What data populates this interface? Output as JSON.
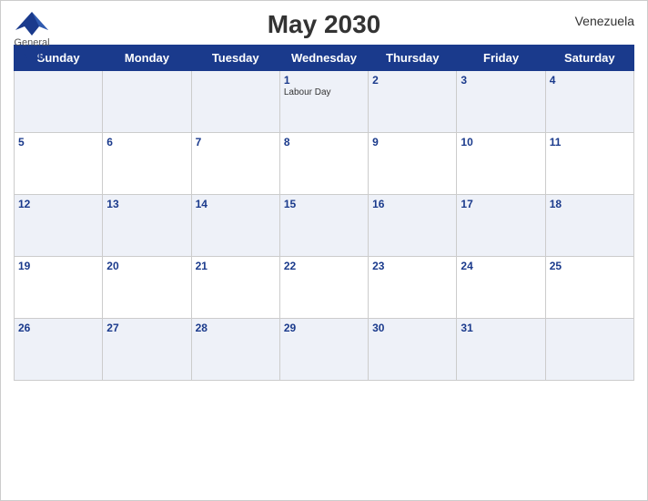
{
  "header": {
    "title": "May 2030",
    "country": "Venezuela",
    "logo": {
      "line1": "General",
      "line2": "Blue"
    }
  },
  "days_of_week": [
    "Sunday",
    "Monday",
    "Tuesday",
    "Wednesday",
    "Thursday",
    "Friday",
    "Saturday"
  ],
  "weeks": [
    [
      {
        "day": "",
        "holiday": ""
      },
      {
        "day": "",
        "holiday": ""
      },
      {
        "day": "",
        "holiday": ""
      },
      {
        "day": "1",
        "holiday": "Labour Day"
      },
      {
        "day": "2",
        "holiday": ""
      },
      {
        "day": "3",
        "holiday": ""
      },
      {
        "day": "4",
        "holiday": ""
      }
    ],
    [
      {
        "day": "5",
        "holiday": ""
      },
      {
        "day": "6",
        "holiday": ""
      },
      {
        "day": "7",
        "holiday": ""
      },
      {
        "day": "8",
        "holiday": ""
      },
      {
        "day": "9",
        "holiday": ""
      },
      {
        "day": "10",
        "holiday": ""
      },
      {
        "day": "11",
        "holiday": ""
      }
    ],
    [
      {
        "day": "12",
        "holiday": ""
      },
      {
        "day": "13",
        "holiday": ""
      },
      {
        "day": "14",
        "holiday": ""
      },
      {
        "day": "15",
        "holiday": ""
      },
      {
        "day": "16",
        "holiday": ""
      },
      {
        "day": "17",
        "holiday": ""
      },
      {
        "day": "18",
        "holiday": ""
      }
    ],
    [
      {
        "day": "19",
        "holiday": ""
      },
      {
        "day": "20",
        "holiday": ""
      },
      {
        "day": "21",
        "holiday": ""
      },
      {
        "day": "22",
        "holiday": ""
      },
      {
        "day": "23",
        "holiday": ""
      },
      {
        "day": "24",
        "holiday": ""
      },
      {
        "day": "25",
        "holiday": ""
      }
    ],
    [
      {
        "day": "26",
        "holiday": ""
      },
      {
        "day": "27",
        "holiday": ""
      },
      {
        "day": "28",
        "holiday": ""
      },
      {
        "day": "29",
        "holiday": ""
      },
      {
        "day": "30",
        "holiday": ""
      },
      {
        "day": "31",
        "holiday": ""
      },
      {
        "day": "",
        "holiday": ""
      }
    ]
  ]
}
